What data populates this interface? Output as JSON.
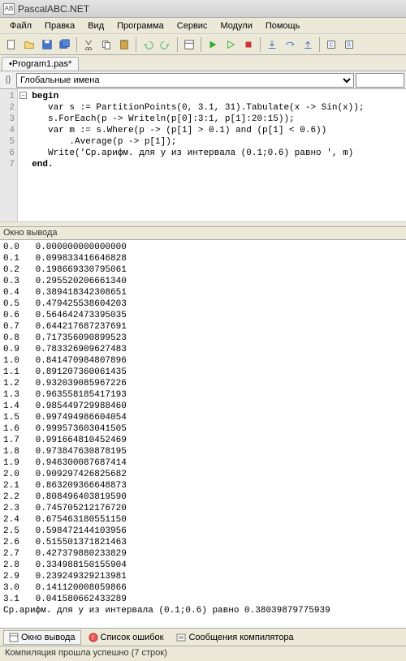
{
  "window": {
    "title": "PascalABC.NET"
  },
  "menu": {
    "file": "Файл",
    "edit": "Правка",
    "view": "Вид",
    "program": "Программа",
    "service": "Сервис",
    "modules": "Модули",
    "help": "Помощь"
  },
  "tabs": {
    "active": "•Program1.pas*"
  },
  "scope": {
    "select": "Глобальные имена",
    "filter": ""
  },
  "code": {
    "lines": [
      "begin",
      "   var s := PartitionPoints(0, 3.1, 31).Tabulate(x -> Sin(x));",
      "   s.ForEach(p -> Writeln(p[0]:3:1, p[1]:20:15));",
      "   var m := s.Where(p -> (p[1] > 0.1) and (p[1] < 0.6))",
      "       .Average(p -> p[1]);",
      "   Write('Ср.арифм. для y из интервала (0.1;0.6) равно ', m)",
      "end."
    ]
  },
  "output_panel": {
    "title": "Окно вывода"
  },
  "output": {
    "rows": [
      [
        "0.0",
        "0.000000000000000"
      ],
      [
        "0.1",
        "0.099833416646828"
      ],
      [
        "0.2",
        "0.198669330795061"
      ],
      [
        "0.3",
        "0.295520206661340"
      ],
      [
        "0.4",
        "0.389418342308651"
      ],
      [
        "0.5",
        "0.479425538604203"
      ],
      [
        "0.6",
        "0.564642473395035"
      ],
      [
        "0.7",
        "0.644217687237691"
      ],
      [
        "0.8",
        "0.717356090899523"
      ],
      [
        "0.9",
        "0.783326909627483"
      ],
      [
        "1.0",
        "0.841470984807896"
      ],
      [
        "1.1",
        "0.891207360061435"
      ],
      [
        "1.2",
        "0.932039085967226"
      ],
      [
        "1.3",
        "0.963558185417193"
      ],
      [
        "1.4",
        "0.985449729988460"
      ],
      [
        "1.5",
        "0.997494986604054"
      ],
      [
        "1.6",
        "0.999573603041505"
      ],
      [
        "1.7",
        "0.991664810452469"
      ],
      [
        "1.8",
        "0.973847630878195"
      ],
      [
        "1.9",
        "0.946300087687414"
      ],
      [
        "2.0",
        "0.909297426825682"
      ],
      [
        "2.1",
        "0.863209366648873"
      ],
      [
        "2.2",
        "0.808496403819590"
      ],
      [
        "2.3",
        "0.745705212176720"
      ],
      [
        "2.4",
        "0.675463180551150"
      ],
      [
        "2.5",
        "0.598472144103956"
      ],
      [
        "2.6",
        "0.515501371821463"
      ],
      [
        "2.7",
        "0.427379880233829"
      ],
      [
        "2.8",
        "0.334988150155904"
      ],
      [
        "2.9",
        "0.239249329213981"
      ],
      [
        "3.0",
        "0.141120008059866"
      ],
      [
        "3.1",
        "0.041580662433289"
      ]
    ],
    "summary": "Ср.арифм. для y из интервала (0.1;0.6) равно 0.38039879775939"
  },
  "bottom_tabs": {
    "output": "Окно вывода",
    "errors": "Список ошибок",
    "compiler": "Сообщения компилятора"
  },
  "status": {
    "text": "Компиляция прошла успешно (7 строк)"
  }
}
